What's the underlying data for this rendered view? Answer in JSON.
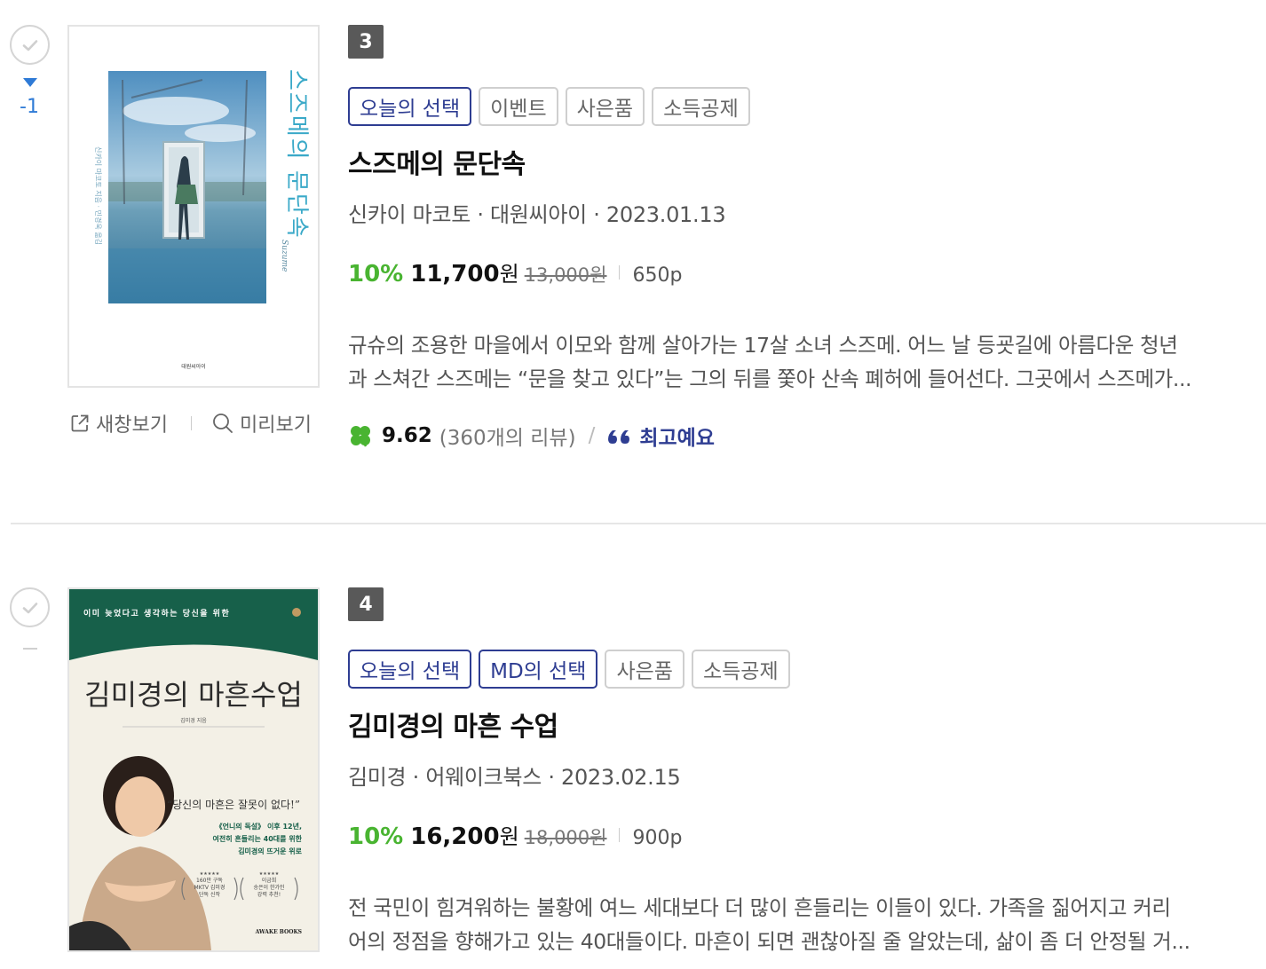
{
  "items": [
    {
      "rank_change": "-1",
      "rank": "3",
      "tags": [
        "오늘의 선택",
        "이벤트",
        "사은품",
        "소득공제"
      ],
      "title": "스즈메의 문단속",
      "meta": "신카이 마코토 · 대원씨아이 · 2023.01.13",
      "discount": "10%",
      "price": "11,700",
      "price_unit": "원",
      "original_price": "13,000원",
      "pages": "650p",
      "description": [
        "규슈의 조용한 마을에서 이모와 함께 살아가는 17살 소녀 스즈메. 어느 날 등굣길에 아름다운 청년",
        "과 스쳐간 스즈메는 “문을 찾고 있다”는 그의 뒤를 쫓아 산속 폐허에 들어선다. 그곳에서 스즈메가..."
      ],
      "rating": "9.62",
      "review_count": "(360개의 리뷰)",
      "review_separator": "/",
      "review_quote": "최고예요",
      "new_window_label": "새창보기",
      "preview_label": "미리보기",
      "cover": {
        "title_vertical": "스즈메의 문단속",
        "author_vertical": "신카이 마코토 지음 · 민경욱 옮김",
        "subtitle_vertical": "Suzume",
        "publisher_mark": "대원씨아이"
      }
    },
    {
      "rank": "4",
      "tags": [
        "오늘의 선택",
        "MD의 선택",
        "사은품",
        "소득공제"
      ],
      "title": "김미경의 마흔 수업",
      "meta": "김미경 · 어웨이크북스 · 2023.02.15",
      "discount": "10%",
      "price": "16,200",
      "price_unit": "원",
      "original_price": "18,000원",
      "pages": "900p",
      "description": [
        "전 국민이 힘겨워하는 불황에 여느 세대보다 더 많이 흔들리는 이들이 있다. 가족을 짊어지고 커리",
        "어의 정점을 향해가고 있는 40대들이다. 마흔이 되면 괜찮아질 줄 알았는데, 삶이 좀 더 안정될 거..."
      ],
      "cover": {
        "top_line": "이미 늦었다고 생각하는 당신을 위한",
        "title": "김미경의 마흔수업",
        "author": "김미경 지음",
        "quote": "“당신의 마흔은 잘못이 없다!”",
        "blurb": [
          "《언니의 독설》 이후 12년,",
          "여전히 흔들리는 40대를 위한",
          "김미경의 뜨거운 위로"
        ],
        "laurel_left": [
          "★★★★★",
          "160만 구독",
          "MKTV 김미경",
          "단독 신작"
        ],
        "laurel_right": [
          "★★★★★",
          "이금희",
          "송은이 한가인",
          "강력 추천!"
        ],
        "publisher_mark": "AWAKE BOOKS"
      }
    }
  ],
  "colors": {
    "accent_blue": "#2e7ad6",
    "tag_navy": "#2e3d92",
    "discount_green": "#49b431",
    "rank_badge": "#595959"
  }
}
